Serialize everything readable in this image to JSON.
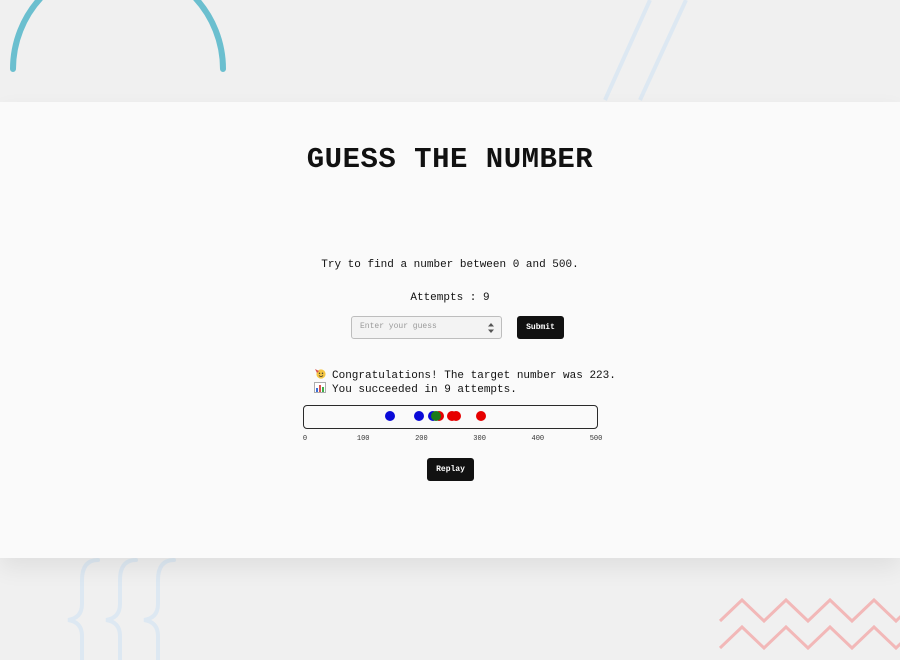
{
  "game": {
    "title": "GUESS THE NUMBER",
    "instruction": "Try to find a number between 0 and 500.",
    "attempts_label": "Attempts",
    "attempts_separator": " : ",
    "attempts_count": "9",
    "input": {
      "placeholder": "Enter your guess",
      "value": ""
    },
    "submit_label": "Submit",
    "result": {
      "congrats_icon": "party-face-icon",
      "congrats": "Congratulations! The target number was 223.",
      "summary_icon": "bar-chart-icon",
      "summary": "You succeeded in 9 attempts."
    },
    "replay_label": "Replay"
  },
  "guess_track": {
    "min": 0,
    "max": 500,
    "ticks": [
      "0",
      "100",
      "200",
      "300",
      "400",
      "500"
    ],
    "tick_values": [
      0,
      100,
      200,
      300,
      400,
      500
    ],
    "target": 223,
    "guesses": [
      {
        "value": 145,
        "status": "low"
      },
      {
        "value": 195,
        "status": "low"
      },
      {
        "value": 218,
        "status": "low"
      },
      {
        "value": 223,
        "status": "correct"
      },
      {
        "value": 228,
        "status": "high"
      },
      {
        "value": 250,
        "status": "high"
      },
      {
        "value": 257,
        "status": "high"
      },
      {
        "value": 300,
        "status": "high"
      }
    ],
    "colors": {
      "low": "#0a0ad8",
      "correct": "#1b7a1b",
      "high": "#e60000"
    }
  },
  "theme": {
    "background": "#f0f0f0",
    "card": "#fafafa",
    "button": "#111111",
    "deco_arc": "#6bbfcf",
    "deco_lines": "#dde8f2",
    "deco_zigzag": "#f2b8b8"
  }
}
